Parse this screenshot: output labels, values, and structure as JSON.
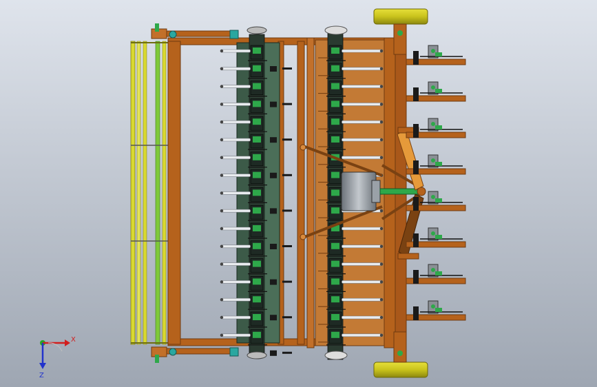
{
  "colors": {
    "bg_top": "#dfe4ec",
    "bg_bottom": "#9ea6b2",
    "frame": "#b5621c",
    "frame_dark": "#6e3a10",
    "frame_light": "#d98a3c",
    "tube_yellow": "#d9d930",
    "tube_green": "#7fc93a",
    "shaft_dark": "#2f4a3a",
    "module_green": "#2ea84a",
    "module_dark": "#1e2a24",
    "teal": "#2aa7a0",
    "tine": "#e9ecef",
    "wheel": "#c9c31c",
    "gearbox": "#8a9198",
    "axis_x": "#d21e1e",
    "axis_y": "#26a626",
    "axis_z": "#2233cc"
  },
  "triad": {
    "x_label": "X",
    "z_label": "Z"
  }
}
